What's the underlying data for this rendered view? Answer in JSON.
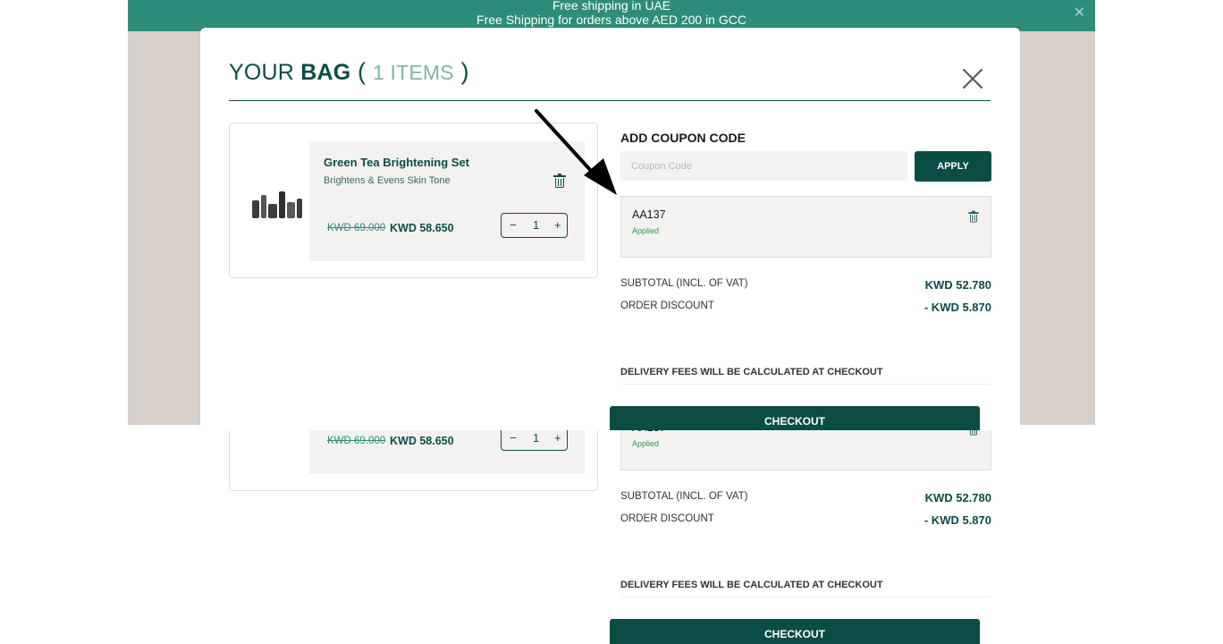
{
  "topbar": {
    "line1": "Free shipping in UAE",
    "line2": "Free Shipping for orders above AED 200 in GCC",
    "close": "✕"
  },
  "bag": {
    "title_prefix": "YOUR ",
    "title_bold": "BAG",
    "open_paren": " ( ",
    "count": "1 ITEMS",
    "close_paren": " )"
  },
  "item": {
    "name": "Green Tea Brightening Set",
    "subtitle": "Brightens & Evens Skin Tone",
    "old_price": "KWD 69.000",
    "new_price": "KWD 58.650",
    "quantity": "1",
    "minus": "−",
    "plus": "+"
  },
  "coupon": {
    "title": "ADD COUPON CODE",
    "placeholder": "Coupon Code",
    "apply_label": "APPLY",
    "applied_code": "AA137",
    "applied_status": "Applied"
  },
  "summary": {
    "subtotal_label": "SUBTOTAL (INCL. OF VAT)",
    "subtotal_value": "KWD 52.780",
    "discount_label": "ORDER DISCOUNT",
    "discount_value": "- KWD 5.870"
  },
  "delivery_note": "DELIVERY FEES WILL BE CALCULATED AT CHECKOUT",
  "checkout_label": "CHECKOUT",
  "colors": {
    "brand": "#0b4d45",
    "topbar": "#2e8c7a",
    "backdrop": "#d8d0ca",
    "applied_green": "#2a9a55"
  }
}
